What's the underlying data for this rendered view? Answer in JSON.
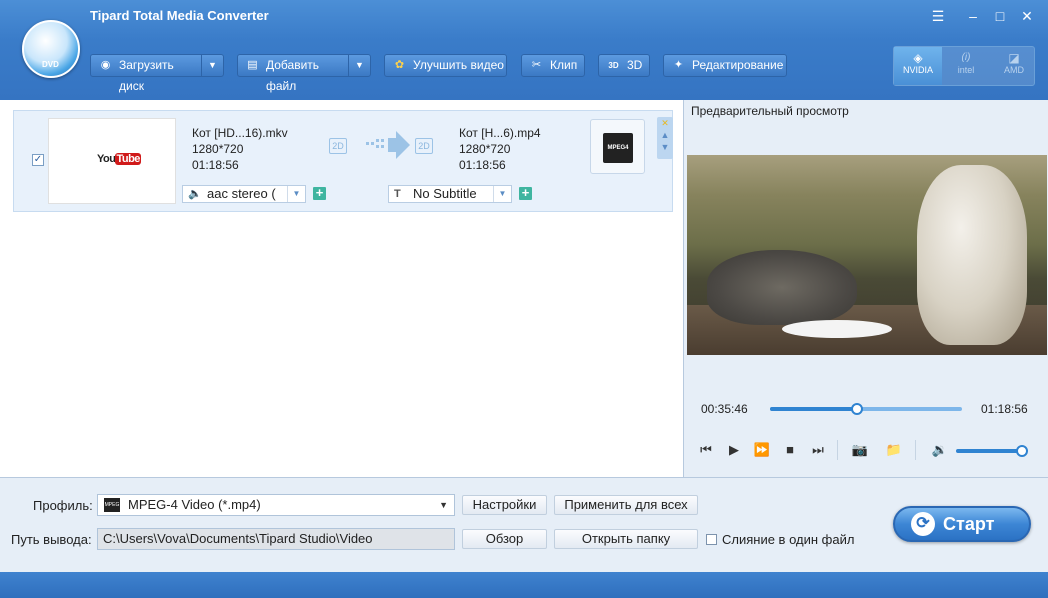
{
  "app": {
    "title": "Tipard Total Media Converter"
  },
  "window_controls": {
    "menu": "☰",
    "minimize": "–",
    "maximize": "□",
    "close": "✕"
  },
  "logo": {
    "label": "DVD"
  },
  "toolbar": {
    "load_disc": "Загрузить диск",
    "add_file": "Добавить файл",
    "enhance": "Улучшить видео",
    "clip": "Клип",
    "threed": "3D",
    "edit": "Редактирование"
  },
  "accelerators": {
    "nvidia": "NVIDIA",
    "intel": "intel",
    "amd": "AMD"
  },
  "file": {
    "checked": true,
    "source_name": "Кот [HD...16).mkv",
    "source_res": "1280*720",
    "source_dur": "01:18:56",
    "output_name": "Кот [H...6).mp4",
    "output_res": "1280*720",
    "output_dur": "01:18:56",
    "badge_in": "2D",
    "badge_out": "2D",
    "audio_track": "aac stereo (",
    "subtitle": "No Subtitle",
    "thumbnail_text": "You",
    "thumbnail_text2": "Tube",
    "format_icon": "MPEG4"
  },
  "preview": {
    "title": "Предварительный просмотр",
    "time_current": "00:35:46",
    "time_total": "01:18:56",
    "progress": 0.453,
    "volume": 1.0
  },
  "bottom": {
    "profile_label": "Профиль:",
    "profile_value": "MPEG-4 Video (*.mp4)",
    "profile_icon": "MPEG",
    "settings_btn": "Настройки",
    "apply_all_btn": "Применить для всех",
    "path_label": "Путь вывода:",
    "path_value": "C:\\Users\\Vova\\Documents\\Tipard Studio\\Video",
    "browse_btn": "Обзор",
    "open_folder_btn": "Открыть папку",
    "merge_label": "Слияние в один файл",
    "start_btn": "Старт"
  },
  "colors": {
    "accent": "#3574c2",
    "highlight_row": "#e8f1fb",
    "progress": "#2f83d1"
  }
}
